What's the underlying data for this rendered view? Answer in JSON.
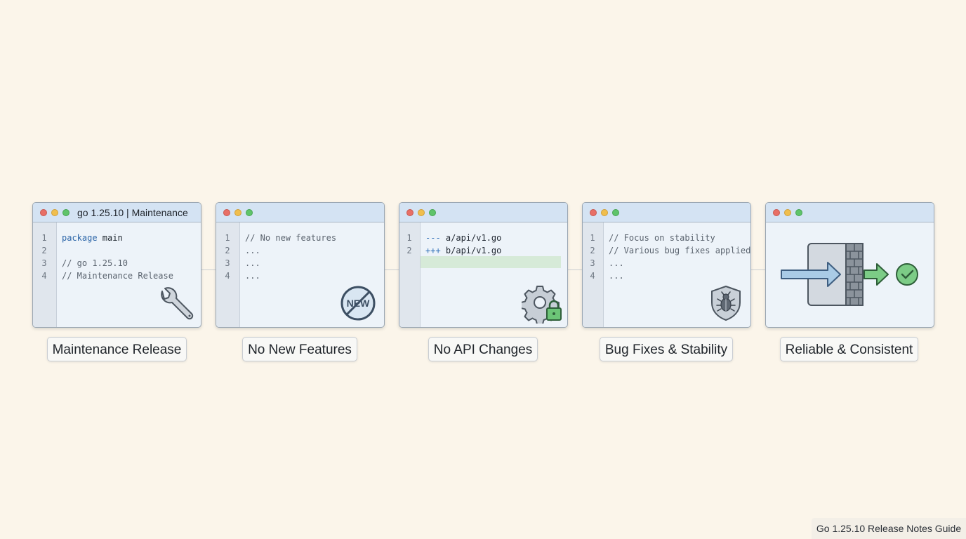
{
  "panels": [
    {
      "title": "go 1.25.10 | Maintenance",
      "lines": [
        {
          "num": "1",
          "code": "package main"
        },
        {
          "num": "2",
          "code": ""
        },
        {
          "num": "3",
          "code": "// go 1.25.10"
        },
        {
          "num": "4",
          "code": "// Maintenance Release"
        }
      ],
      "icon": "wrench-icon",
      "label": "Maintenance Release"
    },
    {
      "title": "",
      "lines": [
        {
          "num": "1",
          "code": "// No new features"
        },
        {
          "num": "2",
          "code": "..."
        },
        {
          "num": "3",
          "code": "..."
        },
        {
          "num": "4",
          "code": "..."
        }
      ],
      "icon": "no-new-icon",
      "icon_text": "NEW",
      "label": "No New Features"
    },
    {
      "title": "",
      "lines": [
        {
          "num": "1",
          "code_prefix": "---",
          "code": " a/api/v1.go"
        },
        {
          "num": "2",
          "code_prefix": "+++",
          "code": " b/api/v1.go"
        }
      ],
      "icon": "gear-lock-icon",
      "label": "No API Changes"
    },
    {
      "title": "",
      "lines": [
        {
          "num": "1",
          "code": "// Focus on stability"
        },
        {
          "num": "2",
          "code": "// Various bug fixes applied"
        },
        {
          "num": "3",
          "code": "..."
        },
        {
          "num": "4",
          "code": "..."
        }
      ],
      "icon": "shield-bug-icon",
      "label": "Bug Fixes & Stability"
    },
    {
      "title": "",
      "lines": [],
      "icon": "firewall-check-icon",
      "label": "Reliable & Consistent"
    }
  ],
  "footer": {
    "text": "Go 1.25.10 Release Notes Guide"
  },
  "colors": {
    "background": "#fbf5ea",
    "titlebar": "#d4e3f3",
    "accent_green": "#5fc46a",
    "keyword_blue": "#2b65a8"
  }
}
